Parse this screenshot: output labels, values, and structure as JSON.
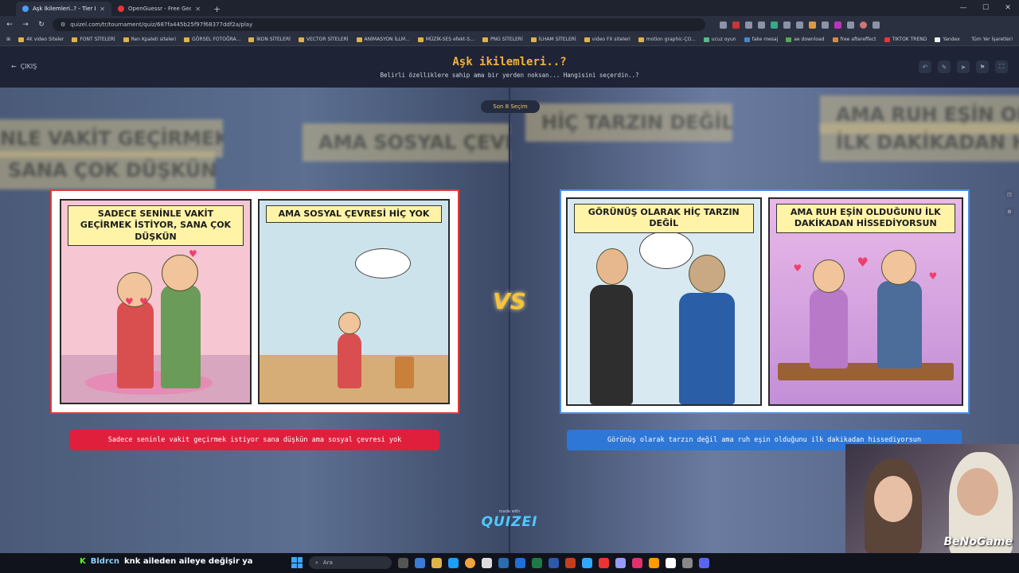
{
  "browser": {
    "tabs": [
      {
        "title": "Aşk İkilemleri..? - Tier List, Kör S",
        "active": true
      },
      {
        "title": "OpenGuessr - Free GeoGu...",
        "active": false
      }
    ],
    "url": "quizel.com/tr/tournament/quiz/687fa445b25f97f68377ddf2a/play",
    "bookmarks": [
      "4K video Siteler",
      "FONT SİTELERİ",
      "Ren Kpaleti siteleri",
      "GÖRSEL FOTOĞRA...",
      "İKON SİTELERİ",
      "VECTOR SİTELERİ",
      "ANİMASYON İLLM...",
      "MÜZİK-SES efekt-S...",
      "PNG SİTELERİ",
      "İLHAM SİTELERİ",
      "video FX siteleri",
      "motion graphic-ÇO...",
      "ucuz oyun",
      "fake mesaj",
      "ae download",
      "free aftereffect",
      "TIKTOK TREND",
      "Yandex"
    ],
    "bookmarks_right": "Tüm Yer İşaretleri"
  },
  "header": {
    "back_label": "ÇIKIŞ",
    "title": "Aşk ikilemleri..?",
    "subtitle": "Belirli özelliklere sahip ama bir yerden noksan... Hangisini seçerdin..?"
  },
  "round_label": "Son 8 Seçim",
  "vs_label": "VS",
  "left_option": {
    "panel1_caption": "SADECE SENİNLE VAKİT GEÇİRMEK İSTİYOR, SANA ÇOK DÜŞKÜN",
    "panel2_caption": "AMA SOSYAL ÇEVRESİ HİÇ YOK",
    "caption": "Sadece seninle vakit geçirmek istiyor sana düşkün ama sosyal çevresi yok",
    "accent": "#e01f3d"
  },
  "right_option": {
    "panel1_caption": "GÖRÜNÜŞ OLARAK HİÇ TARZIN DEĞİL",
    "panel2_caption": "AMA RUH EŞİN OLDUĞUNU İLK DAKİKADAN HİSSEDİYORSUN",
    "caption": "Görünüş olarak tarzın değil ama ruh eşin olduğunu ilk dakikadan hissediyorsun",
    "accent": "#2f77d6"
  },
  "brand": {
    "made_with": "made with",
    "logo": "QUIZEI"
  },
  "background_text": {
    "left1": "NLE VAKİT GEÇİRMEK",
    "left2": "SANA ÇOK DÜŞKÜN",
    "left3": "AMA SOSYAL ÇEVRE",
    "right1": "HİÇ TARZIN DEĞİL",
    "right2": "AMA RUH EŞİN OL",
    "right3": "İLK DAKİKADAN HİSS"
  },
  "webcam_overlay": "BeNoGame",
  "taskbar": {
    "chat_user": "Bldrcn",
    "chat_message": "knk aileden aileye değişir ya",
    "search_placeholder": "Ara"
  }
}
